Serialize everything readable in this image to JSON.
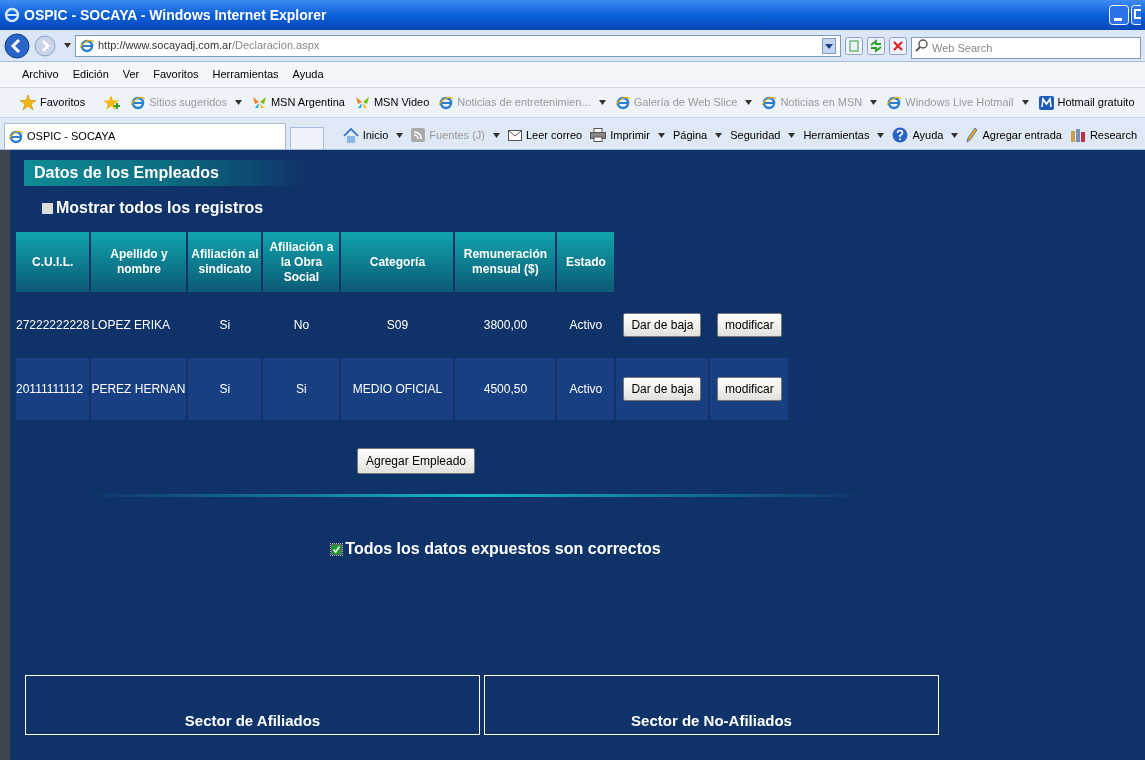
{
  "window": {
    "title": "OSPIC - SOCAYA - Windows Internet Explorer"
  },
  "address_bar": {
    "host": "http://www.socayadj.com.ar",
    "path": "/Declaracion.aspx"
  },
  "search": {
    "placeholder": "Web Search"
  },
  "menu_bar": [
    "Archivo",
    "Edición",
    "Ver",
    "Favoritos",
    "Herramientas",
    "Ayuda"
  ],
  "favorites_bar": {
    "label": "Favoritos",
    "items": [
      {
        "label": "Sitios sugeridos",
        "kind": "ie",
        "disabled": true,
        "dropdown": true
      },
      {
        "label": "MSN Argentina",
        "kind": "msn",
        "disabled": false,
        "dropdown": false
      },
      {
        "label": "MSN Video",
        "kind": "msn",
        "disabled": false,
        "dropdown": false
      },
      {
        "label": "Noticias de entretenimien...",
        "kind": "ie",
        "disabled": true,
        "dropdown": true
      },
      {
        "label": "Galería de Web Slice",
        "kind": "ie",
        "disabled": true,
        "dropdown": true
      },
      {
        "label": "Noticias en MSN",
        "kind": "ie",
        "disabled": true,
        "dropdown": true
      },
      {
        "label": "Windows Live Hotmail",
        "kind": "ie",
        "disabled": true,
        "dropdown": true
      },
      {
        "label": "Hotmail gratuito",
        "kind": "hotmail",
        "disabled": false,
        "dropdown": false
      }
    ]
  },
  "tab": {
    "title": "OSPIC - SOCAYA"
  },
  "command_bar": [
    {
      "label": "Inicio",
      "kind": "home",
      "disabled": false,
      "dropdown": true
    },
    {
      "label": "Fuentes (J)",
      "kind": "feed",
      "disabled": true,
      "dropdown": true
    },
    {
      "label": "Leer correo",
      "kind": "mail",
      "disabled": false,
      "dropdown": false
    },
    {
      "label": "Imprimir",
      "kind": "print",
      "disabled": false,
      "dropdown": true
    },
    {
      "label": "Página",
      "kind": "none",
      "disabled": false,
      "dropdown": true
    },
    {
      "label": "Seguridad",
      "kind": "none",
      "disabled": false,
      "dropdown": true
    },
    {
      "label": "Herramientas",
      "kind": "none",
      "disabled": false,
      "dropdown": true
    },
    {
      "label": "Ayuda",
      "kind": "help",
      "disabled": false,
      "dropdown": true
    },
    {
      "label": "Agregar entrada",
      "kind": "pen",
      "disabled": false,
      "dropdown": false
    },
    {
      "label": "Research",
      "kind": "research",
      "disabled": false,
      "dropdown": false
    }
  ],
  "page": {
    "section_title": "Datos de los Empleados",
    "show_all": {
      "label": "Mostrar todos los registros",
      "checked": false
    },
    "table": {
      "columns": [
        "C.U.I.L.",
        "Apellido y nombre",
        "Afiliación al sindicato",
        "Afiliación a la Obra Social",
        "Categoría",
        "Remuneración mensual ($)",
        "Estado"
      ],
      "rows": [
        {
          "cells": [
            "27222222228",
            "LOPEZ ERIKA",
            "Si",
            "No",
            "S09",
            "3800,00",
            "Activo"
          ],
          "actions": [
            "Dar de baja",
            "modificar"
          ]
        },
        {
          "cells": [
            "20111111112",
            "PEREZ HERNAN",
            "Si",
            "Si",
            "MEDIO OFICIAL",
            "4500,50",
            "Activo"
          ],
          "actions": [
            "Dar de baja",
            "modificar"
          ]
        }
      ]
    },
    "add_button": "Agregar Empleado",
    "confirm": {
      "label": "Todos los datos expuestos son correctos",
      "checked": true
    },
    "sectors": [
      "Sector de Afiliados",
      "Sector de No-Afiliados"
    ]
  }
}
